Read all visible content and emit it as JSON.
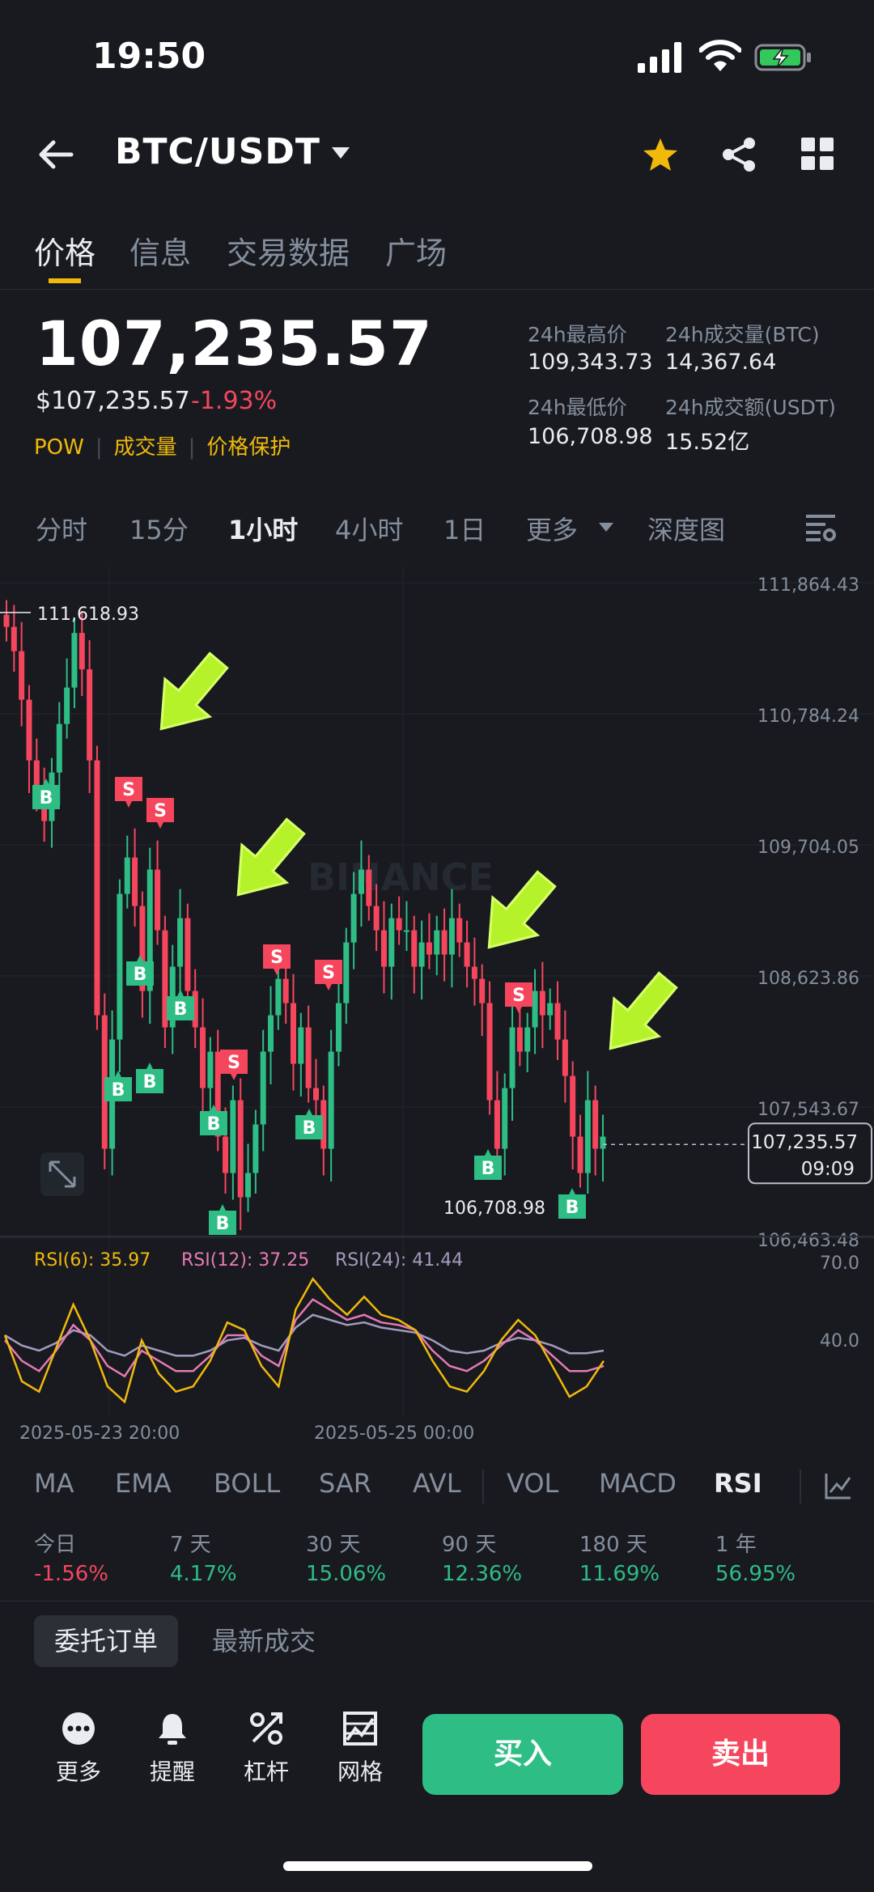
{
  "status": {
    "time": "19:50"
  },
  "header": {
    "pair": "BTC/USDT"
  },
  "tabs": [
    "价格",
    "信息",
    "交易数据",
    "广场"
  ],
  "price": {
    "last": "107,235.57",
    "usd": "$107,235.57",
    "change": "-1.93%",
    "tags": [
      "POW",
      "成交量",
      "价格保护"
    ]
  },
  "stats": {
    "high_label": "24h最高价",
    "high": "109,343.73",
    "vol_btc_label": "24h成交量(BTC)",
    "vol_btc": "14,367.64",
    "low_label": "24h最低价",
    "low": "106,708.98",
    "vol_usdt_label": "24h成交额(USDT)",
    "vol_usdt": "15.52亿"
  },
  "timeframes": [
    "分时",
    "15分",
    "1小时",
    "4小时",
    "1日",
    "更多",
    "深度图"
  ],
  "active_timeframe": "1小时",
  "chart": {
    "watermark": "BINANCE",
    "price_axis": [
      "111,864.43",
      "110,784.24",
      "109,704.05",
      "108,623.86",
      "107,543.67",
      "106,463.48"
    ],
    "high_marker": "111,618.93",
    "low_marker": "106,708.98",
    "current_price": "107,235.57",
    "current_time": "09:09",
    "rsi": {
      "rsi6": "RSI(6): 35.97",
      "rsi12": "RSI(12): 37.25",
      "rsi24": "RSI(24): 41.44",
      "axis_top": "70.0",
      "axis_mid": "40.0"
    },
    "x_labels": [
      "2025-05-23 20:00",
      "2025-05-25 00:00"
    ],
    "buy_marker": "B",
    "sell_marker": "S"
  },
  "chart_data": {
    "type": "candlestick",
    "ylim": [
      106463.48,
      111864.43
    ],
    "y_ticks": [
      111864.43,
      110784.24,
      109704.05,
      108623.86,
      107543.67,
      106463.48
    ],
    "x_ticks": [
      "2025-05-23 20:00",
      "2025-05-25 00:00"
    ],
    "annotations": {
      "high": 111618.93,
      "low": 106708.98,
      "last": 107235.57
    },
    "rsi_series": [
      {
        "name": "RSI(6)",
        "last": 35.97,
        "color": "#f0b90b"
      },
      {
        "name": "RSI(12)",
        "last": 37.25,
        "color": "#e57ab5"
      },
      {
        "name": "RSI(24)",
        "last": 41.44,
        "color": "#a39bbd"
      }
    ]
  },
  "indicators": [
    "MA",
    "EMA",
    "BOLL",
    "SAR",
    "AVL",
    "VOL",
    "MACD",
    "RSI"
  ],
  "active_indicator": "RSI",
  "performance": [
    {
      "label": "今日",
      "value": "-1.56%",
      "dir": "down"
    },
    {
      "label": "7 天",
      "value": "4.17%",
      "dir": "up"
    },
    {
      "label": "30 天",
      "value": "15.06%",
      "dir": "up"
    },
    {
      "label": "90 天",
      "value": "12.36%",
      "dir": "up"
    },
    {
      "label": "180 天",
      "value": "11.69%",
      "dir": "up"
    },
    {
      "label": "1 年",
      "value": "56.95%",
      "dir": "up"
    }
  ],
  "order_tabs": [
    "委托订单",
    "最新成交"
  ],
  "bottom_bar": {
    "more": "更多",
    "alert": "提醒",
    "leverage": "杠杆",
    "grid": "网格",
    "buy": "买入",
    "sell": "卖出"
  },
  "colors": {
    "up": "#2ebd85",
    "down": "#f6465d",
    "accent": "#f0b90b",
    "bg": "#181a20"
  }
}
